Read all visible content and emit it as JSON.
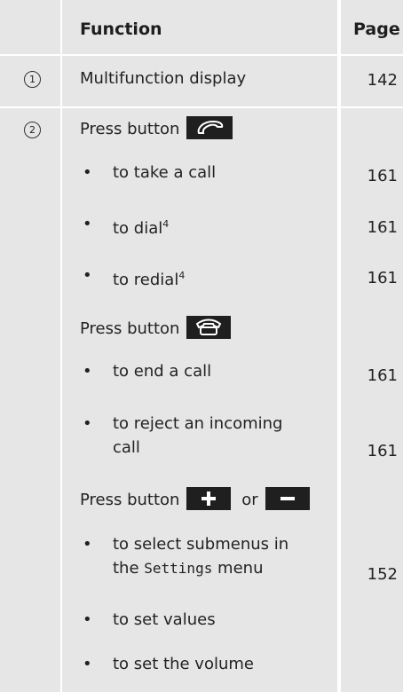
{
  "header": {
    "function_label": "Function",
    "page_label": "Page"
  },
  "row1": {
    "number": "1",
    "text": "Multifunction display",
    "page": "142"
  },
  "row2": {
    "number": "2",
    "press_button_accept": "Press button",
    "accept_icon": "phone-accept-icon",
    "items_a": [
      {
        "text": "to take a call",
        "page": "161"
      },
      {
        "text": "to dial",
        "sup": "4",
        "page": "161"
      },
      {
        "text": "to redial",
        "sup": "4",
        "page": "161"
      }
    ],
    "press_button_end": "Press button",
    "end_icon": "phone-end-icon",
    "items_b": [
      {
        "text": "to end a call",
        "page": "161"
      },
      {
        "line1": "to reject an incoming",
        "line2": "call",
        "page": "161"
      }
    ],
    "press_button_plus": "Press button",
    "or_text": "or",
    "plus_icon": "plus-icon",
    "minus_icon": "minus-icon",
    "items_c": [
      {
        "line1": "to select submenus in",
        "line2_pre": "the ",
        "line2_mono": "Settings",
        "line2_post": " menu",
        "page": "152"
      },
      {
        "text": "to set values"
      },
      {
        "text": "to set the volume"
      }
    ],
    "bullet": "•"
  }
}
